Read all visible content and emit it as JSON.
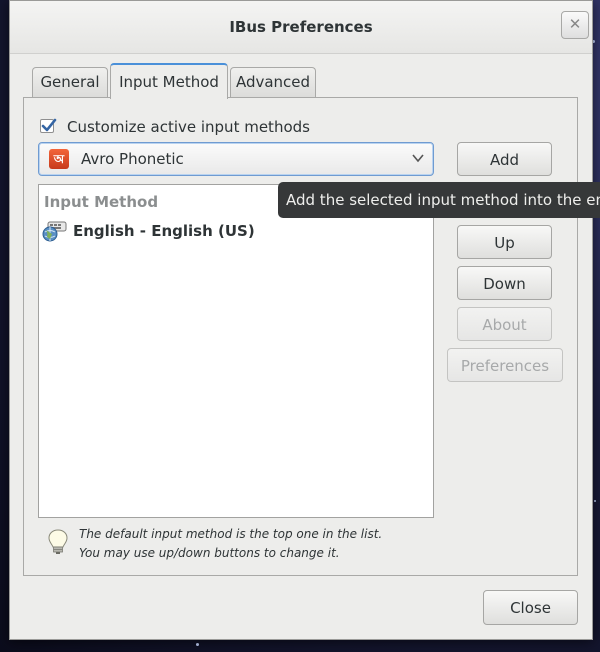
{
  "window": {
    "title": "IBus Preferences",
    "close_glyph": "✕"
  },
  "tabs": [
    {
      "label": "General",
      "active": false
    },
    {
      "label": "Input Method",
      "active": true
    },
    {
      "label": "Advanced",
      "active": false
    }
  ],
  "customize": {
    "label": "Customize active input methods",
    "checked": true
  },
  "combo": {
    "value": "Avro Phonetic",
    "icon": "avro-icon",
    "icon_glyph": "অ"
  },
  "list": {
    "header": "Input Method",
    "rows": [
      {
        "label": "English - English (US)",
        "icon": "keyboard-icon"
      }
    ]
  },
  "buttons": {
    "add": "Add",
    "up": "Up",
    "down": "Down",
    "about": "About",
    "preferences": "Preferences",
    "close": "Close"
  },
  "tooltip": "Add the selected input method into the enab",
  "hint": {
    "line1": "The default input method is the top one in the list.",
    "line2": "You may use up/down buttons to change it."
  },
  "colors": {
    "accent": "#4a90d9",
    "tooltip_bg": "#363839",
    "avro": "#e2522a"
  }
}
